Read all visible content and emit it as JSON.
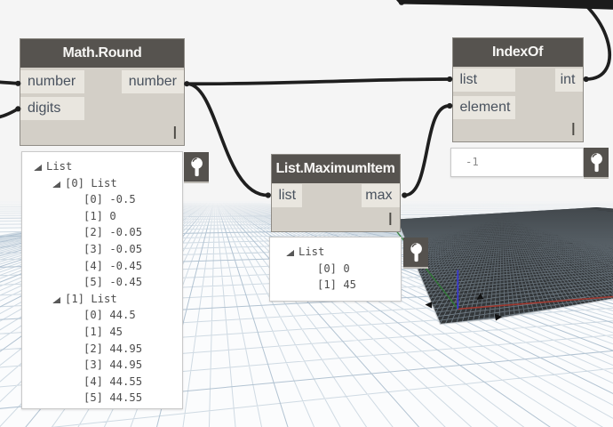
{
  "app": {
    "name": "Dynamo graph workspace"
  },
  "colors": {
    "canvas": "#f5f5f5",
    "node_header": "#56534f",
    "node_body": "#d3cfc7",
    "node_port": "#e9e6df",
    "node_header_text": "#f7f6f4",
    "port_text": "#49525e",
    "wire": "#1f1f1f",
    "bubble_bg": "#ffffff",
    "bubble_text": "#4b4b4b",
    "pin_bg": "#55524e",
    "grid_minor": "#ccd8e2",
    "grid_major": "#aabfd0",
    "plane": "#33373a",
    "axis_x": "#b03a2e",
    "axis_y": "#2e7d32",
    "axis_z": "#3b3bd1"
  },
  "nodes": [
    {
      "id": "math-round",
      "title": "Math.Round",
      "inputs": [
        "number",
        "digits"
      ],
      "outputs": [
        "number"
      ],
      "lacing": "|"
    },
    {
      "id": "list-maximumitem",
      "title": "List.MaximumItem",
      "inputs": [
        "list"
      ],
      "outputs": [
        "max"
      ],
      "lacing": "|"
    },
    {
      "id": "indexof",
      "title": "IndexOf",
      "inputs": [
        "list",
        "element"
      ],
      "outputs": [
        "int"
      ],
      "lacing": "|"
    }
  ],
  "bubbles": [
    {
      "of": "Math.Round",
      "rows": [
        {
          "text": "List"
        },
        {
          "text": "[0] List"
        },
        {
          "text": "[0] -0.5"
        },
        {
          "text": "[1] 0"
        },
        {
          "text": "[2] -0.05"
        },
        {
          "text": "[3] -0.05"
        },
        {
          "text": "[4] -0.45"
        },
        {
          "text": "[5] -0.45"
        },
        {
          "text": "[1] List"
        },
        {
          "text": "[0] 44.5"
        },
        {
          "text": "[1] 45"
        },
        {
          "text": "[2] 44.95"
        },
        {
          "text": "[3] 44.95"
        },
        {
          "text": "[4] 44.55"
        },
        {
          "text": "[5] 44.55"
        }
      ]
    },
    {
      "of": "List.MaximumItem",
      "rows": [
        {
          "text": "List"
        },
        {
          "text": "[0] 0"
        },
        {
          "text": "[1] 45"
        }
      ]
    },
    {
      "of": "IndexOf",
      "value": "-1"
    }
  ],
  "wires": [
    {
      "from": "offscreen-left",
      "to": "Math.Round.number"
    },
    {
      "from": "offscreen-left",
      "to": "Math.Round.digits"
    },
    {
      "from": "Math.Round.number",
      "to": "IndexOf.list"
    },
    {
      "from": "Math.Round.number",
      "to": "List.MaximumItem.list"
    },
    {
      "from": "List.MaximumItem.max",
      "to": "IndexOf.element"
    },
    {
      "from": "IndexOf.int",
      "to": "offscreen-top-right"
    },
    {
      "from": "offscreen-top",
      "to": "offscreen-right"
    }
  ],
  "preview3d": {
    "description": "background 3D preview with perspective grid, dark surface and origin axes"
  }
}
